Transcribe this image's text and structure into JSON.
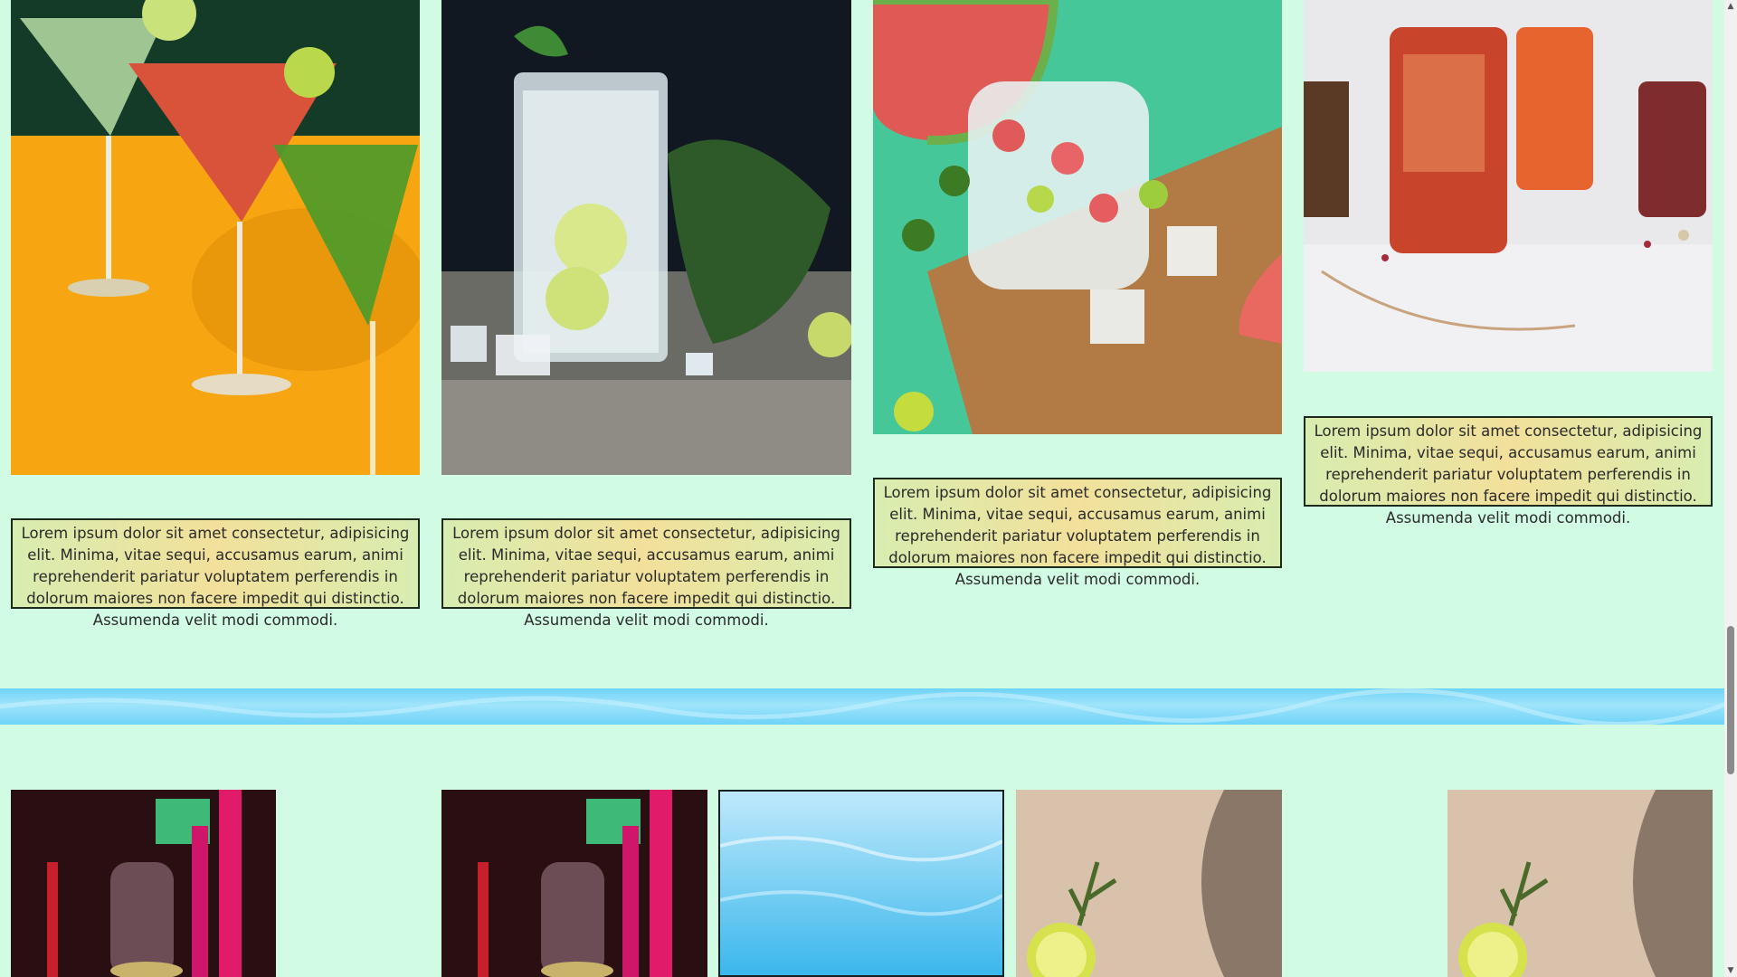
{
  "gallery": {
    "cards": [
      {
        "image": "orange-martini-cocktails-photo",
        "caption": "Lorem ipsum dolor sit amet consectetur, adipisicing elit. Minima, vitae sequi, accusamus earum, animi reprehenderit pariatur voluptatem perferendis in dolorum maiores non facere impedit qui distinctio. Assumenda velit modi commodi."
      },
      {
        "image": "mojito-glass-photo",
        "caption": "Lorem ipsum dolor sit amet consectetur, adipisicing elit. Minima, vitae sequi, accusamus earum, animi reprehenderit pariatur voluptatem perferendis in dolorum maiores non facere impedit qui distinctio. Assumenda velit modi commodi."
      },
      {
        "image": "watermelon-drink-photo",
        "caption": "Lorem ipsum dolor sit amet consectetur, adipisicing elit. Minima, vitae sequi, accusamus earum, animi reprehenderit pariatur voluptatem perferendis in dolorum maiores non facere impedit qui distinctio. Assumenda velit modi commodi."
      },
      {
        "image": "iced-tea-glasses-photo",
        "caption": "Lorem ipsum dolor sit amet consectetur, adipisicing elit. Minima, vitae sequi, accusamus earum, animi reprehenderit pariatur voluptatem perferendis in dolorum maiores non facere impedit qui distinctio. Assumenda velit modi commodi."
      }
    ]
  },
  "second_row": {
    "images": [
      "wine-glasses-neon-photo",
      "wine-glasses-neon-photo",
      "water-surface-photo",
      "lime-rosemary-photo",
      "lime-rosemary-photo"
    ]
  },
  "colors": {
    "background": "#d2fbe4",
    "caption_border": "#1b2a1b",
    "band": "#6fd3f7"
  },
  "scrollbar": {
    "up_icon": "triangle-up-icon",
    "down_icon": "triangle-down-icon"
  }
}
